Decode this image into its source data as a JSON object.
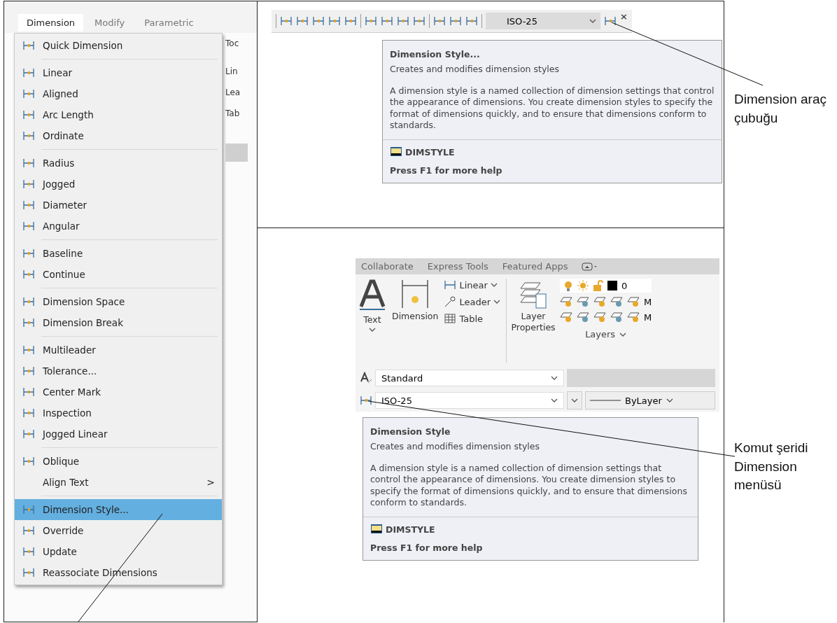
{
  "menu_panel": {
    "menu_bar": [
      {
        "label": "Dimension",
        "selected": true
      },
      {
        "label": "Modify",
        "selected": false
      },
      {
        "label": "Parametric",
        "selected": false
      }
    ],
    "background_fragments": [
      "Toc",
      "Lin",
      "Lea",
      "Tab"
    ],
    "menu_groups": [
      [
        {
          "label": "Quick Dimension",
          "kind": "command",
          "selected": false
        }
      ],
      [
        {
          "label": "Linear",
          "kind": "command",
          "selected": false
        },
        {
          "label": "Aligned",
          "kind": "command",
          "selected": false
        },
        {
          "label": "Arc Length",
          "kind": "command",
          "selected": false
        },
        {
          "label": "Ordinate",
          "kind": "command",
          "selected": false
        }
      ],
      [
        {
          "label": "Radius",
          "kind": "command",
          "selected": false
        },
        {
          "label": "Jogged",
          "kind": "command",
          "selected": false
        },
        {
          "label": "Diameter",
          "kind": "command",
          "selected": false
        },
        {
          "label": "Angular",
          "kind": "command",
          "selected": false
        }
      ],
      [
        {
          "label": "Baseline",
          "kind": "command",
          "selected": false
        },
        {
          "label": "Continue",
          "kind": "command",
          "selected": false
        }
      ],
      [
        {
          "label": "Dimension Space",
          "kind": "command",
          "selected": false
        },
        {
          "label": "Dimension Break",
          "kind": "command",
          "selected": false
        }
      ],
      [
        {
          "label": "Multileader",
          "kind": "command",
          "selected": false
        },
        {
          "label": "Tolerance...",
          "kind": "command",
          "selected": false
        },
        {
          "label": "Center Mark",
          "kind": "command",
          "selected": false
        },
        {
          "label": "Inspection",
          "kind": "command",
          "selected": false
        },
        {
          "label": "Jogged Linear",
          "kind": "command",
          "selected": false
        }
      ],
      [
        {
          "label": "Oblique",
          "kind": "command",
          "selected": false
        },
        {
          "label": "Align Text",
          "kind": "submenu",
          "arrow": ">",
          "selected": false
        }
      ],
      [
        {
          "label": "Dimension Style...",
          "kind": "command",
          "selected": true
        },
        {
          "label": "Override",
          "kind": "command",
          "selected": false
        },
        {
          "label": "Update",
          "kind": "command",
          "selected": false
        },
        {
          "label": "Reassociate Dimensions",
          "kind": "command",
          "selected": false
        }
      ]
    ]
  },
  "toolbar_panel": {
    "style_combo": "ISO-25",
    "close": "×",
    "tooltip": {
      "title": "Dimension Style...",
      "subtitle": "Creates and modifies dimension styles",
      "description": "A dimension style is a named collection of dimension settings that control the appearance of dimensions. You create dimension styles to specify the format of dimensions quickly, and to ensure that dimensions conform to standards.",
      "command": "DIMSTYLE",
      "help": "Press F1 for more help"
    }
  },
  "ribbon_panel": {
    "tabs": [
      "Collaborate",
      "Express Tools",
      "Featured Apps"
    ],
    "text_tool": "Text",
    "dimension_tool": "Dimension",
    "linear": "Linear",
    "leader": "Leader",
    "table": "Table",
    "layer_properties": "Layer Properties",
    "layer_value": "0",
    "row_fragments": [
      "M",
      "M"
    ],
    "layers_title": "Layers",
    "text_style": "Standard",
    "dim_style": "ISO-25",
    "linetype": "ByLayer",
    "tooltip": {
      "title": "Dimension Style",
      "subtitle": "Creates and modifies dimension styles",
      "description": "A dimension style is a named collection of dimension settings that control the appearance of dimensions. You create dimension styles to specify the format of dimensions quickly, and to ensure that dimensions conform to standards.",
      "command": "DIMSTYLE",
      "help": "Press F1 for more help"
    }
  },
  "annotations": [
    "Dimension araç çubuğu",
    "Komut şeridi Dimension menüsü"
  ]
}
